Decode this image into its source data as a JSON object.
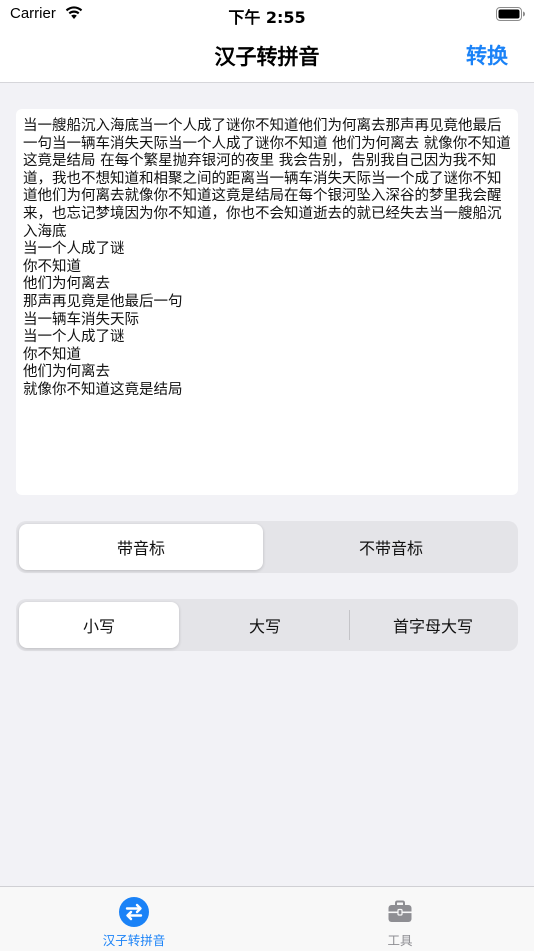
{
  "status_bar": {
    "carrier": "Carrier",
    "time": "下午 2:55"
  },
  "nav": {
    "title": "汉子转拼音",
    "action_label": "转换"
  },
  "input": {
    "text": "当一艘船沉入海底当一个人成了谜你不知道他们为何离去那声再见竟他最后一句当一辆车消失天际当一个人成了谜你不知道 他们为何离去 就像你不知道这竟是结局 在每个繁星抛弃银河的夜里 我会告别，告别我自己因为我不知道，我也不想知道和相聚之间的距离当一辆车消失天际当一个成了谜你不知道他们为何离去就像你不知道这竟是结局在每个银河坠入深谷的梦里我会醒来，也忘记梦境因为你不知道，你也不会知道逝去的就已经失去当一艘船沉入海底\n当一个人成了谜\n你不知道\n他们为何离去\n那声再见竟是他最后一句\n当一辆车消失天际\n当一个人成了谜\n你不知道\n他们为何离去\n就像你不知道这竟是结局"
  },
  "tone_segment": {
    "options": [
      "带音标",
      "不带音标"
    ],
    "selected": "带音标"
  },
  "case_segment": {
    "options": [
      "小写",
      "大写",
      "首字母大写"
    ],
    "selected": "小写"
  },
  "tab_bar": {
    "tabs": [
      {
        "label": "汉子转拼音",
        "icon": "swap-arrows-icon",
        "active": true
      },
      {
        "label": "工具",
        "icon": "toolbox-icon",
        "active": false
      }
    ]
  },
  "colors": {
    "accent": "#1a82f7",
    "background": "#f2f2f6",
    "segment_bg": "#e4e4e8",
    "inactive_tab": "#8e8e93"
  }
}
